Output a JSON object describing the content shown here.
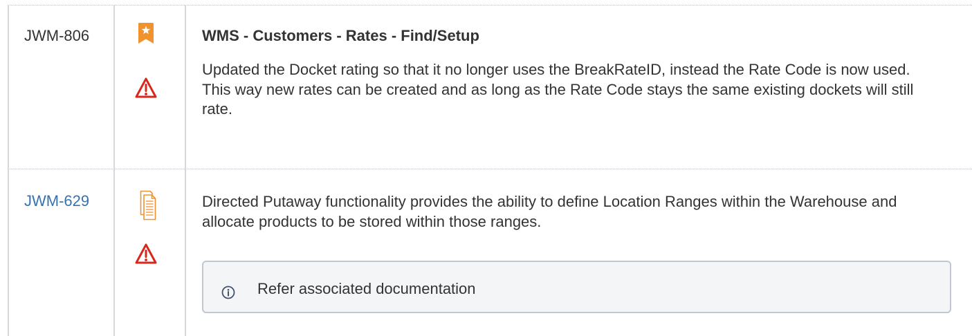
{
  "table": {
    "rows": [
      {
        "key": "JWM-806",
        "icons": [
          "star-bookmark-icon",
          "warning-icon"
        ],
        "title": "WMS - Customers - Rates - Find/Setup",
        "description": "Updated the Docket rating so that it no longer uses the BreakRateID, instead the Rate Code is now used. This way new rates can be created and as long as the Rate Code stays the same existing dockets will still rate."
      },
      {
        "key": "JWM-629",
        "icons": [
          "document-icon",
          "warning-icon"
        ],
        "description": "Directed Putaway functionality provides the ability to define Location Ranges within the Warehouse and allocate products to be stored within those ranges.",
        "info_panel": {
          "icon": "info-icon",
          "text": "Refer associated documentation"
        }
      }
    ]
  },
  "colors": {
    "text": "#333333",
    "link": "#3572b0",
    "icon_orange": "#f0932f",
    "warning_red": "#d7281e",
    "table_border": "#d6d8dc",
    "panel_background": "#f4f5f7",
    "panel_border": "#c1c7d0",
    "info_icon": "#42526e"
  }
}
